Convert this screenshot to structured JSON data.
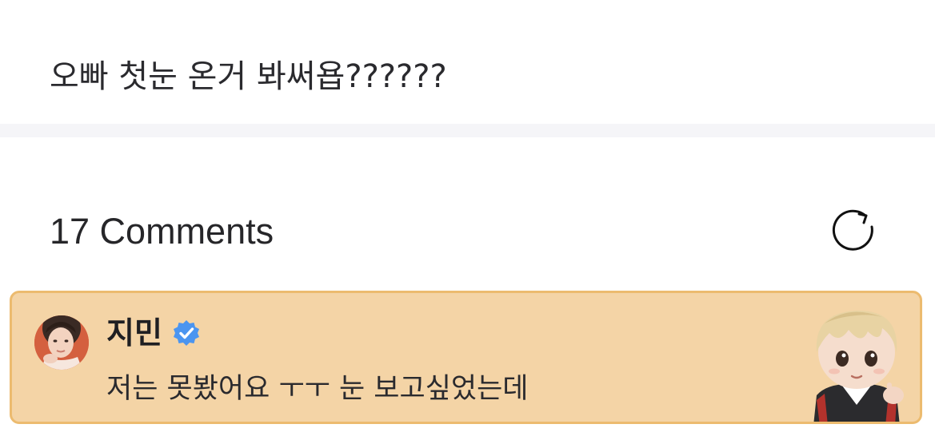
{
  "post": {
    "text": "오빠 첫눈 온거 봐써욥??????"
  },
  "comments": {
    "title": "17 Comments",
    "refresh_icon": "refresh-icon"
  },
  "pinned_comment": {
    "author": "지민",
    "verified_icon": "verified-badge-icon",
    "text": "저는 못봤어요 ㅜㅜ 눈 보고싶었는데",
    "avatar": "avatar-photo",
    "sticker": "character-sticker"
  },
  "colors": {
    "highlight_background": "#f4d4a6",
    "highlight_border": "#ecbb6f",
    "verified_blue": "#4b95f0",
    "divider": "#f5f5f8"
  }
}
